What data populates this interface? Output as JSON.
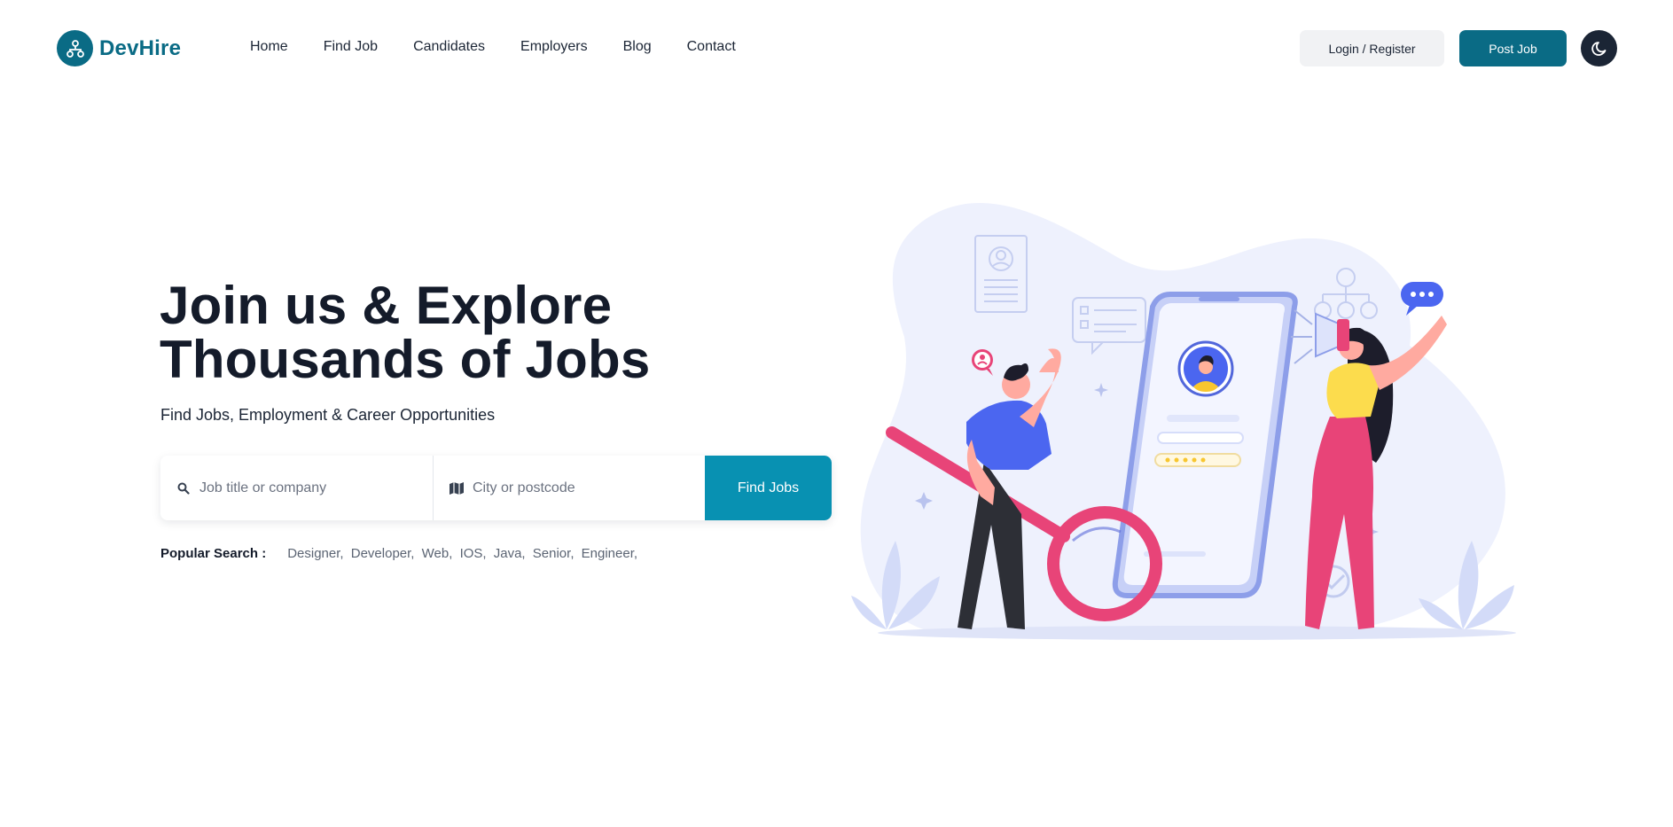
{
  "brand": {
    "name": "DevHire"
  },
  "nav": [
    "Home",
    "Find Job",
    "Candidates",
    "Employers",
    "Blog",
    "Contact"
  ],
  "header_actions": {
    "login": "Login / Register",
    "post_job": "Post Job"
  },
  "hero": {
    "title_line1": "Join us & Explore",
    "title_line2": "Thousands of Jobs",
    "subtitle": "Find Jobs, Employment & Career Opportunities"
  },
  "search": {
    "keyword_placeholder": "Job title or company",
    "location_placeholder": "City or postcode",
    "button": "Find Jobs"
  },
  "popular": {
    "label": "Popular Search :",
    "tags": [
      "Designer,",
      "Developer,",
      "Web,",
      "IOS,",
      "Java,",
      "Senior,",
      "Engineer,"
    ]
  },
  "icons": {
    "logo": "network-icon",
    "theme": "moon-icon",
    "keyword": "search-icon",
    "location": "map-icon"
  },
  "colors": {
    "brand": "#0a6b85",
    "accent": "#0891b2",
    "dark": "#1b2535"
  }
}
